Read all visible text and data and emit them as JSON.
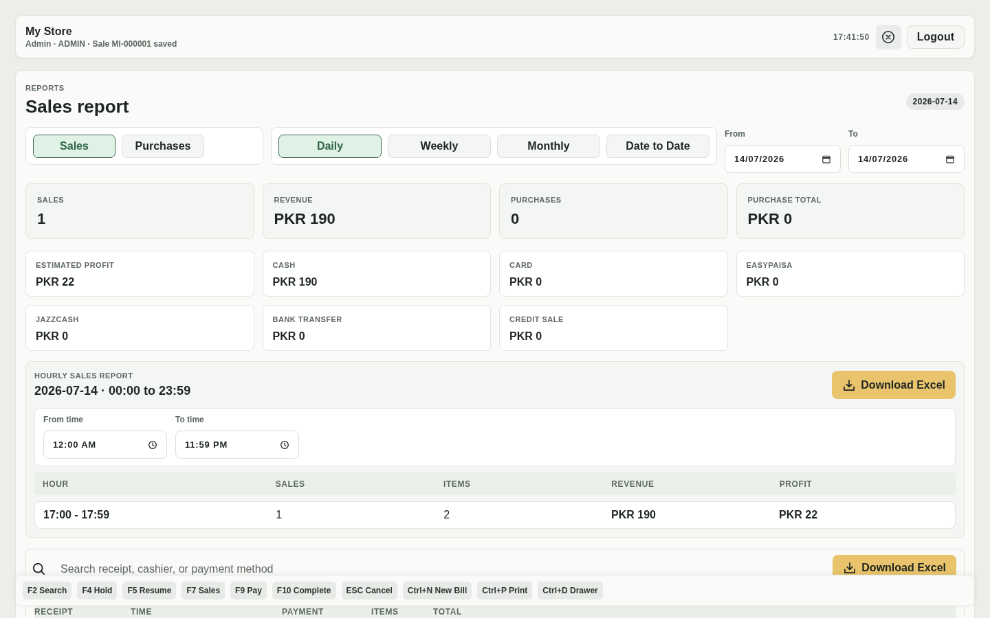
{
  "header": {
    "store_name": "My Store",
    "status": "Admin · ADMIN · Sale MI-000001 saved",
    "clock": "17:41:50",
    "logout": "Logout"
  },
  "report": {
    "eyebrow": "REPORTS",
    "title": "Sales report",
    "date_badge": "2026-07-14"
  },
  "report_types": [
    {
      "label": "Sales",
      "selected": true
    },
    {
      "label": "Purchases",
      "selected": false
    }
  ],
  "periods": [
    {
      "label": "Daily",
      "selected": true
    },
    {
      "label": "Weekly",
      "selected": false
    },
    {
      "label": "Monthly",
      "selected": false
    },
    {
      "label": "Date to Date",
      "selected": false
    }
  ],
  "date_range": [
    {
      "label": "From",
      "value": "14/07/2026"
    },
    {
      "label": "To",
      "value": "14/07/2026"
    }
  ],
  "totals": [
    {
      "label": "SALES",
      "value": "1"
    },
    {
      "label": "REVENUE",
      "value": "PKR 190"
    },
    {
      "label": "PURCHASES",
      "value": "0"
    },
    {
      "label": "PURCHASE TOTAL",
      "value": "PKR 0"
    }
  ],
  "breakdown": [
    {
      "label": "ESTIMATED PROFIT",
      "value": "PKR 22"
    },
    {
      "label": "CASH",
      "value": "PKR 190"
    },
    {
      "label": "CARD",
      "value": "PKR 0"
    },
    {
      "label": "EASYPAISA",
      "value": "PKR 0"
    },
    {
      "label": "JAZZCASH",
      "value": "PKR 0"
    },
    {
      "label": "BANK TRANSFER",
      "value": "PKR 0"
    },
    {
      "label": "CREDIT SALE",
      "value": "PKR 0"
    }
  ],
  "hourly_report": {
    "eyebrow": "HOURLY SALES REPORT",
    "title": "2026-07-14 · 00:00 to 23:59",
    "download": "Download Excel",
    "time_range": [
      {
        "label": "From time",
        "value": "12:00 AM"
      },
      {
        "label": "To time",
        "value": "11:59 PM"
      }
    ],
    "columns": [
      {
        "label": "HOUR",
        "kind": "label"
      },
      {
        "label": "SALES",
        "kind": "count"
      },
      {
        "label": "ITEMS",
        "kind": "count"
      },
      {
        "label": "REVENUE",
        "kind": "money"
      },
      {
        "label": "PROFIT",
        "kind": "money"
      }
    ],
    "rows": [
      [
        "17:00 - 17:59",
        "1",
        "2",
        "PKR 190",
        "PKR 22"
      ]
    ]
  },
  "receipts": {
    "search": {
      "placeholder": "Search receipt, cashier, or payment method"
    },
    "download": "Download Excel",
    "columns": [
      "RECEIPT",
      "TIME",
      "PAYMENT",
      "ITEMS",
      "TOTAL"
    ]
  },
  "shortcuts": [
    "F2 Search",
    "F4 Hold",
    "F5 Resume",
    "F7 Sales",
    "F9 Pay",
    "F10 Complete",
    "ESC Cancel",
    "Ctrl+N New Bill",
    "Ctrl+P Print",
    "Ctrl+D Drawer"
  ]
}
